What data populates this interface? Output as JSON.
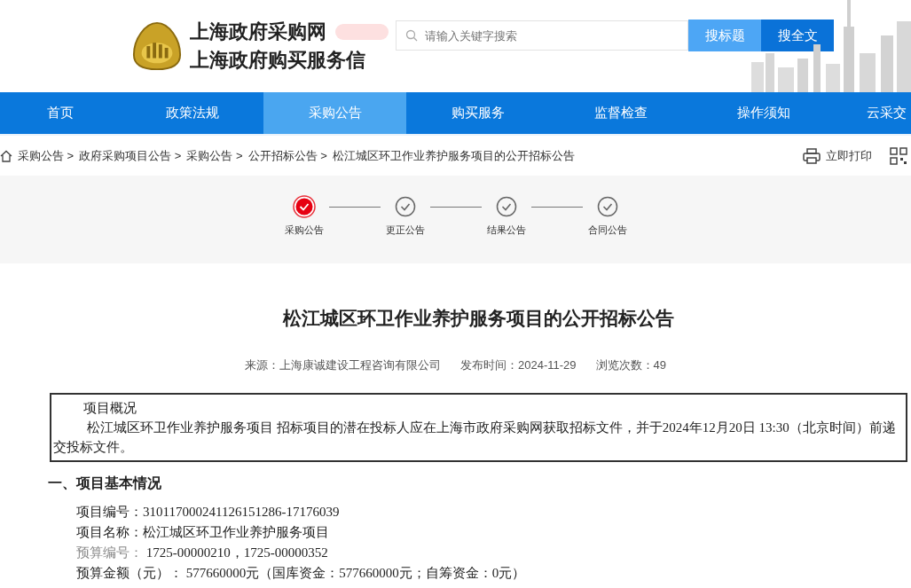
{
  "header": {
    "title_line_1": "上海政府采购网",
    "title_line_2": "上海政府购买服务信",
    "search": {
      "placeholder": "请输入关键字搜索"
    },
    "buttons": [
      {
        "label": "搜标题",
        "selected": false
      },
      {
        "label": "搜全文",
        "selected": true
      }
    ]
  },
  "nav": [
    {
      "label": "首页",
      "selected": false
    },
    {
      "label": "政策法规",
      "selected": false
    },
    {
      "label": "采购公告",
      "selected": true
    },
    {
      "label": "购买服务",
      "selected": false
    },
    {
      "label": "监督检查",
      "selected": false
    },
    {
      "label": "操作须知",
      "selected": false
    },
    {
      "label": "云采交",
      "selected": false
    }
  ],
  "breadcrumb": [
    "采购公告 >",
    "政府采购项目公告 >",
    "采购公告 >",
    "公开招标公告 >",
    "松江城区环卫作业养护服务项目的公开招标公告"
  ],
  "print_label": "立即打印",
  "steps": [
    {
      "label": "采购公告",
      "selected": true
    },
    {
      "label": "更正公告",
      "selected": false
    },
    {
      "label": "结果公告",
      "selected": false
    },
    {
      "label": "合同公告",
      "selected": false
    }
  ],
  "article": {
    "title": "松江城区环卫作业养护服务项目的公开招标公告",
    "meta": [
      "来源：上海康诚建设工程咨询有限公司",
      "发布时间：2024-11-29",
      "浏览次数：49"
    ],
    "overview": {
      "heading": "项目概况",
      "text": "松江城区环卫作业养护服务项目 招标项目的潜在投标人应在上海市政府采购网获取招标文件，并于2024年12月20日 13:30（北京时间）前递交投标文件。"
    },
    "section_heading": "一、项目基本情况",
    "fields": [
      {
        "label": "项目编号：",
        "value": "310117000241126151286-17176039",
        "muted": false
      },
      {
        "label": "项目名称：",
        "value": "松江城区环卫作业养护服务项目",
        "muted": false
      },
      {
        "label": "预算编号：",
        "value": " 1725-00000210，1725-00000352",
        "muted": true
      },
      {
        "label": "预算金额（元）：",
        "value": " 577660000元（国库资金：577660000元；自筹资金：0元）",
        "muted": false
      }
    ]
  }
}
